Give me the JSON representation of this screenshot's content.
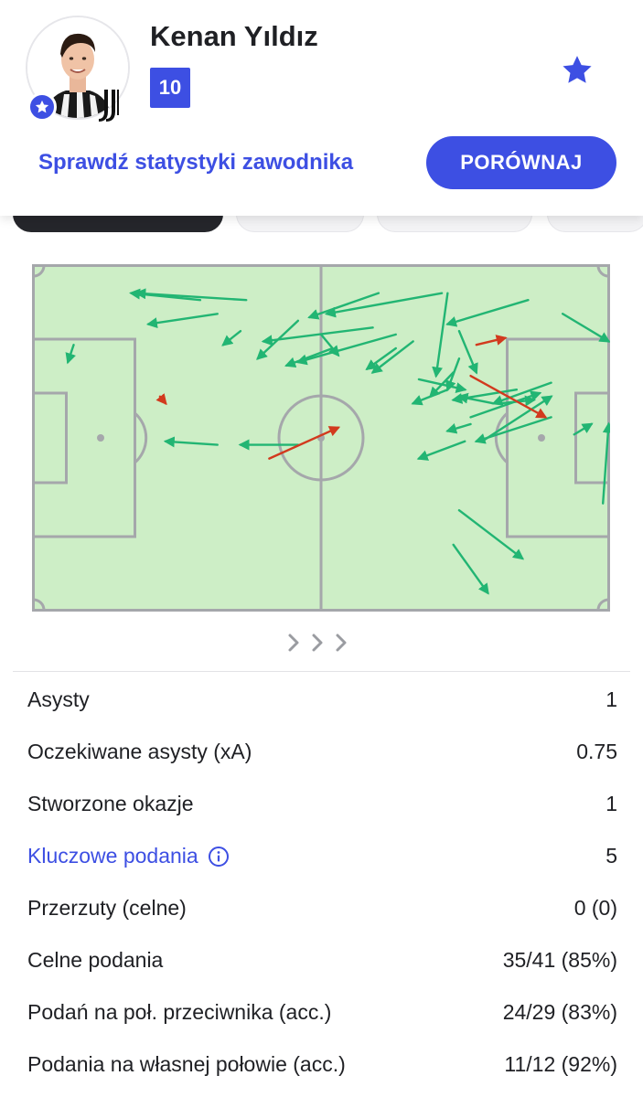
{
  "player": {
    "name": "Kenan Yıldız",
    "number": "10"
  },
  "header": {
    "stats_link": "Sprawdź statystyki zawodnika",
    "compare_button": "PORÓWNAJ"
  },
  "colors": {
    "accent": "#3d4fe3",
    "pitch": "#cdeec6",
    "pitch_lines": "#a5a7ab",
    "pass_success": "#22b573",
    "pass_fail": "#d23a1e"
  },
  "icons": {
    "favorite": "star-icon",
    "badge": "star-badge-icon",
    "more": "chevrons-right-icon",
    "info": "info-icon"
  },
  "pitch_map": {
    "passes": [
      {
        "from": [
          0.37,
          0.1
        ],
        "to": [
          0.18,
          0.08
        ],
        "outcome": "success"
      },
      {
        "from": [
          0.29,
          0.1
        ],
        "to": [
          0.17,
          0.08
        ],
        "outcome": "success"
      },
      {
        "from": [
          0.32,
          0.14
        ],
        "to": [
          0.2,
          0.17
        ],
        "outcome": "success"
      },
      {
        "from": [
          0.6,
          0.08
        ],
        "to": [
          0.48,
          0.15
        ],
        "outcome": "success"
      },
      {
        "from": [
          0.71,
          0.08
        ],
        "to": [
          0.51,
          0.14
        ],
        "outcome": "success"
      },
      {
        "from": [
          0.86,
          0.1
        ],
        "to": [
          0.72,
          0.17
        ],
        "outcome": "success"
      },
      {
        "from": [
          0.92,
          0.14
        ],
        "to": [
          1.01,
          0.22
        ],
        "outcome": "success"
      },
      {
        "from": [
          0.59,
          0.18
        ],
        "to": [
          0.4,
          0.22
        ],
        "outcome": "success"
      },
      {
        "from": [
          0.63,
          0.2
        ],
        "to": [
          0.46,
          0.28
        ],
        "outcome": "success"
      },
      {
        "from": [
          0.66,
          0.22
        ],
        "to": [
          0.59,
          0.31
        ],
        "outcome": "success"
      },
      {
        "from": [
          0.5,
          0.2
        ],
        "to": [
          0.53,
          0.26
        ],
        "outcome": "success"
      },
      {
        "from": [
          0.72,
          0.08
        ],
        "to": [
          0.7,
          0.32
        ],
        "outcome": "success"
      },
      {
        "from": [
          0.74,
          0.19
        ],
        "to": [
          0.77,
          0.31
        ],
        "outcome": "success"
      },
      {
        "from": [
          0.67,
          0.33
        ],
        "to": [
          0.75,
          0.36
        ],
        "outcome": "success"
      },
      {
        "from": [
          0.74,
          0.27
        ],
        "to": [
          0.72,
          0.36
        ],
        "outcome": "success"
      },
      {
        "from": [
          0.73,
          0.31
        ],
        "to": [
          0.69,
          0.38
        ],
        "outcome": "success"
      },
      {
        "from": [
          0.72,
          0.36
        ],
        "to": [
          0.66,
          0.4
        ],
        "outcome": "success"
      },
      {
        "from": [
          0.84,
          0.36
        ],
        "to": [
          0.73,
          0.39
        ],
        "outcome": "success"
      },
      {
        "from": [
          0.9,
          0.34
        ],
        "to": [
          0.8,
          0.4
        ],
        "outcome": "success"
      },
      {
        "from": [
          0.81,
          0.4
        ],
        "to": [
          0.87,
          0.39
        ],
        "outcome": "success"
      },
      {
        "from": [
          0.8,
          0.4
        ],
        "to": [
          0.74,
          0.38
        ],
        "outcome": "success"
      },
      {
        "from": [
          0.75,
          0.51
        ],
        "to": [
          0.67,
          0.56
        ],
        "outcome": "success"
      },
      {
        "from": [
          0.78,
          0.51
        ],
        "to": [
          0.9,
          0.38
        ],
        "outcome": "success"
      },
      {
        "from": [
          0.76,
          0.44
        ],
        "to": [
          0.88,
          0.37
        ],
        "outcome": "success"
      },
      {
        "from": [
          0.9,
          0.44
        ],
        "to": [
          0.77,
          0.51
        ],
        "outcome": "success"
      },
      {
        "from": [
          0.94,
          0.49
        ],
        "to": [
          0.97,
          0.46
        ],
        "outcome": "success"
      },
      {
        "from": [
          0.99,
          0.69
        ],
        "to": [
          1.0,
          0.46
        ],
        "outcome": "success"
      },
      {
        "from": [
          0.74,
          0.71
        ],
        "to": [
          0.85,
          0.85
        ],
        "outcome": "success"
      },
      {
        "from": [
          0.73,
          0.81
        ],
        "to": [
          0.79,
          0.95
        ],
        "outcome": "success"
      },
      {
        "from": [
          0.07,
          0.23
        ],
        "to": [
          0.06,
          0.28
        ],
        "outcome": "success"
      },
      {
        "from": [
          0.32,
          0.52
        ],
        "to": [
          0.23,
          0.51
        ],
        "outcome": "success"
      },
      {
        "from": [
          0.46,
          0.52
        ],
        "to": [
          0.36,
          0.52
        ],
        "outcome": "success"
      },
      {
        "from": [
          0.36,
          0.19
        ],
        "to": [
          0.33,
          0.23
        ],
        "outcome": "success"
      },
      {
        "from": [
          0.46,
          0.16
        ],
        "to": [
          0.39,
          0.27
        ],
        "outcome": "success"
      },
      {
        "from": [
          0.52,
          0.24
        ],
        "to": [
          0.44,
          0.29
        ],
        "outcome": "success"
      },
      {
        "from": [
          0.63,
          0.24
        ],
        "to": [
          0.58,
          0.3
        ],
        "outcome": "success"
      },
      {
        "from": [
          0.76,
          0.46
        ],
        "to": [
          0.72,
          0.48
        ],
        "outcome": "success"
      },
      {
        "from": [
          0.77,
          0.23
        ],
        "to": [
          0.82,
          0.21
        ],
        "outcome": "fail"
      },
      {
        "from": [
          0.76,
          0.32
        ],
        "to": [
          0.89,
          0.44
        ],
        "outcome": "fail"
      },
      {
        "from": [
          0.41,
          0.56
        ],
        "to": [
          0.53,
          0.47
        ],
        "outcome": "fail"
      },
      {
        "from": [
          0.22,
          0.38
        ],
        "to": [
          0.23,
          0.4
        ],
        "outcome": "fail"
      }
    ]
  },
  "stats": [
    {
      "label": "Asysty",
      "value": "1"
    },
    {
      "label": "Oczekiwane asysty (xA)",
      "value": "0.75"
    },
    {
      "label": "Stworzone okazje",
      "value": "1"
    },
    {
      "label": "Kluczowe podania",
      "value": "5",
      "link": true
    },
    {
      "label": "Przerzuty (celne)",
      "value": "0 (0)"
    },
    {
      "label": "Celne podania",
      "value": "35/41 (85%)"
    },
    {
      "label": "Podań na poł. przeciwnika (acc.)",
      "value": "24/29 (83%)"
    },
    {
      "label": "Podania na własnej połowie (acc.)",
      "value": "11/12 (92%)"
    }
  ]
}
